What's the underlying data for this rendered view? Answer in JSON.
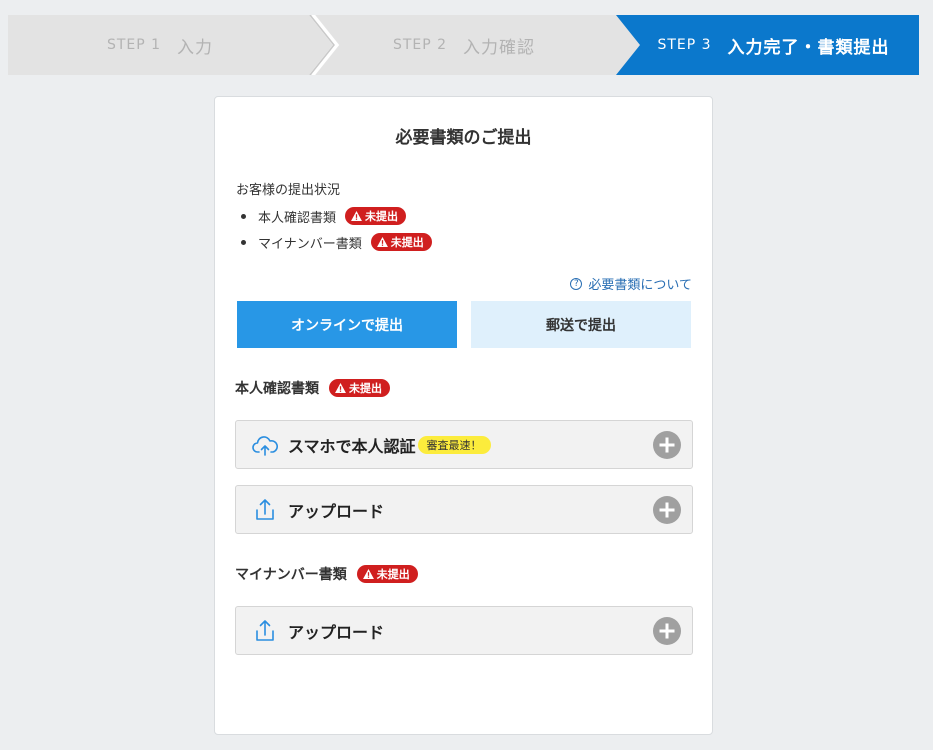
{
  "stepper": {
    "steps": [
      {
        "num": "STEP 1",
        "label": "入力"
      },
      {
        "num": "STEP 2",
        "label": "入力確認"
      },
      {
        "num": "STEP 3",
        "label": "入力完了・書類提出"
      }
    ],
    "active_index": 2,
    "colors": {
      "inactive_bg": "#e3e3e3",
      "active_bg": "#0b78cc"
    }
  },
  "card": {
    "title": "必要書類のご提出",
    "status_label": "お客様の提出状況",
    "status_items": [
      {
        "label": "本人確認書類",
        "badge": "未提出"
      },
      {
        "label": "マイナンバー書類",
        "badge": "未提出"
      }
    ],
    "help_link": "必要書類について",
    "help_icon": "question-circle-icon",
    "buttons": {
      "online": "オンラインで提出",
      "mail": "郵送で提出"
    },
    "sections": {
      "identity": {
        "title": "本人確認書類",
        "badge": "未提出",
        "options": [
          {
            "label": "スマホで本人認証",
            "pill": "審査最速！",
            "icon": "cloud-upload-icon"
          },
          {
            "label": "アップロード",
            "icon": "upload-icon"
          }
        ]
      },
      "mynumber": {
        "title": "マイナンバー書類",
        "badge": "未提出",
        "options": [
          {
            "label": "アップロード",
            "icon": "upload-icon"
          }
        ]
      }
    },
    "colors": {
      "badge": "#d01f1f",
      "primary": "#2897e6",
      "secondary": "#dff0fc",
      "pill": "#fcec3c"
    }
  }
}
